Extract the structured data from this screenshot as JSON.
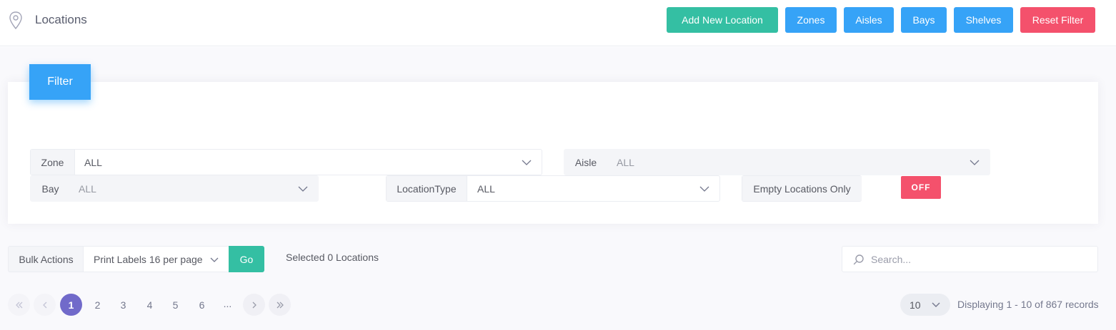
{
  "header": {
    "title": "Locations",
    "buttons": {
      "add_new_location": "Add New Location",
      "zones": "Zones",
      "aisles": "Aisles",
      "bays": "Bays",
      "shelves": "Shelves",
      "reset_filter": "Reset Filter"
    }
  },
  "filter": {
    "tab_label": "Filter",
    "zone": {
      "label": "Zone",
      "value": "ALL"
    },
    "aisle": {
      "label": "Aisle",
      "value": "ALL"
    },
    "bay": {
      "label": "Bay",
      "value": "ALL"
    },
    "location_type": {
      "label": "LocationType",
      "value": "ALL"
    },
    "empty_locations": {
      "label": "Empty Locations Only",
      "toggle": "OFF"
    }
  },
  "bulk": {
    "label": "Bulk Actions",
    "selected_action": "Print Labels 16 per page",
    "go": "Go",
    "selected_text": "Selected 0 Locations"
  },
  "search": {
    "placeholder": "Search..."
  },
  "pagination": {
    "pages": [
      "1",
      "2",
      "3",
      "4",
      "5",
      "6"
    ],
    "ellipsis": "...",
    "current": "1",
    "per_page": "10",
    "display_info": "Displaying 1 - 10 of 867 records"
  },
  "colors": {
    "green": "#34bfa3",
    "blue": "#36a3f7",
    "red": "#f4516c",
    "active_page": "#716aca"
  },
  "icons": {
    "header": "map-pin-icon",
    "search": "search-icon",
    "chevron": "chevron-down-icon",
    "first": "double-chevron-left-icon",
    "prev": "chevron-left-icon",
    "next": "chevron-right-icon",
    "last": "double-chevron-right-icon"
  }
}
